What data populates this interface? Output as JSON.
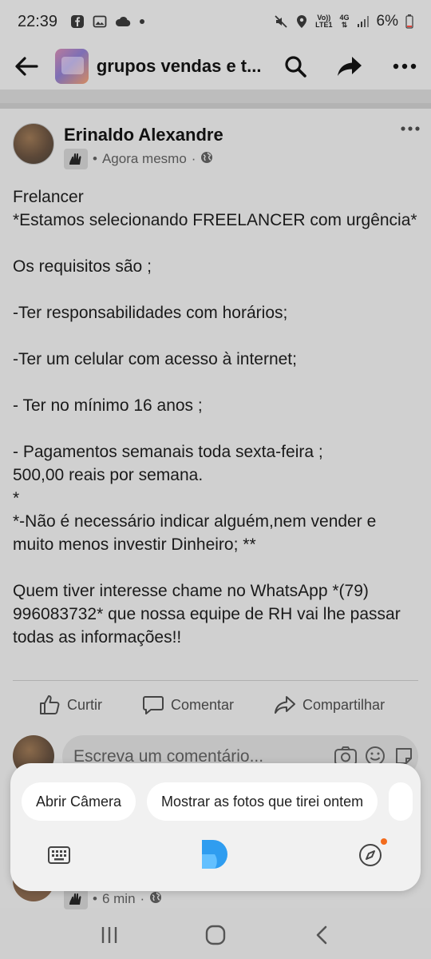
{
  "status_bar": {
    "time": "22:39",
    "net_top": "Vo))",
    "net_bottom": "LTE1",
    "net_4g": "4G",
    "battery": "6%",
    "icons": [
      "facebook-icon",
      "image-icon",
      "cloud-icon",
      "dot-icon",
      "mute-icon",
      "location-icon",
      "signal-icon",
      "battery-icon"
    ]
  },
  "header": {
    "title": "grupos vendas e t...",
    "icons": [
      "back-arrow-icon",
      "search-icon",
      "share-icon",
      "more-icon"
    ]
  },
  "post": {
    "author": "Erinaldo Alexandre",
    "time": "Agora mesmo",
    "separator": "·",
    "bullet": "•",
    "body": [
      "Frelancer",
      "*Estamos selecionando FREELANCER com urgência*",
      "",
      "Os requisitos são ;",
      "",
      "-Ter responsabilidades com horários;",
      "",
      "-Ter um celular com acesso à internet;",
      "",
      "- Ter no mínimo 16 anos ;",
      "",
      "- Pagamentos semanais toda sexta-feira ;",
      "500,00 reais por semana.",
      "*",
      "*-Não é necessário indicar alguém,nem vender e muito menos investir Dinheiro; **",
      "",
      "Quem tiver interesse chame no WhatsApp *(79) 996083732* que nossa equipe de RH vai lhe passar todas as informações!!"
    ],
    "actions": {
      "like": "Curtir",
      "comment": "Comentar",
      "share": "Compartilhar"
    },
    "comment_placeholder": "Escreva um comentário..."
  },
  "next_post": {
    "time": "6 min",
    "separator": "·",
    "bullet": "•"
  },
  "bixby": {
    "chips": [
      "Abrir Câmera",
      "Mostrar as fotos que tirei ontem"
    ],
    "accent": "#2f9df0",
    "dot_color": "#f26b1d"
  },
  "nav_bar": {
    "icons": [
      "recent-apps-icon",
      "home-icon",
      "back-icon"
    ]
  }
}
